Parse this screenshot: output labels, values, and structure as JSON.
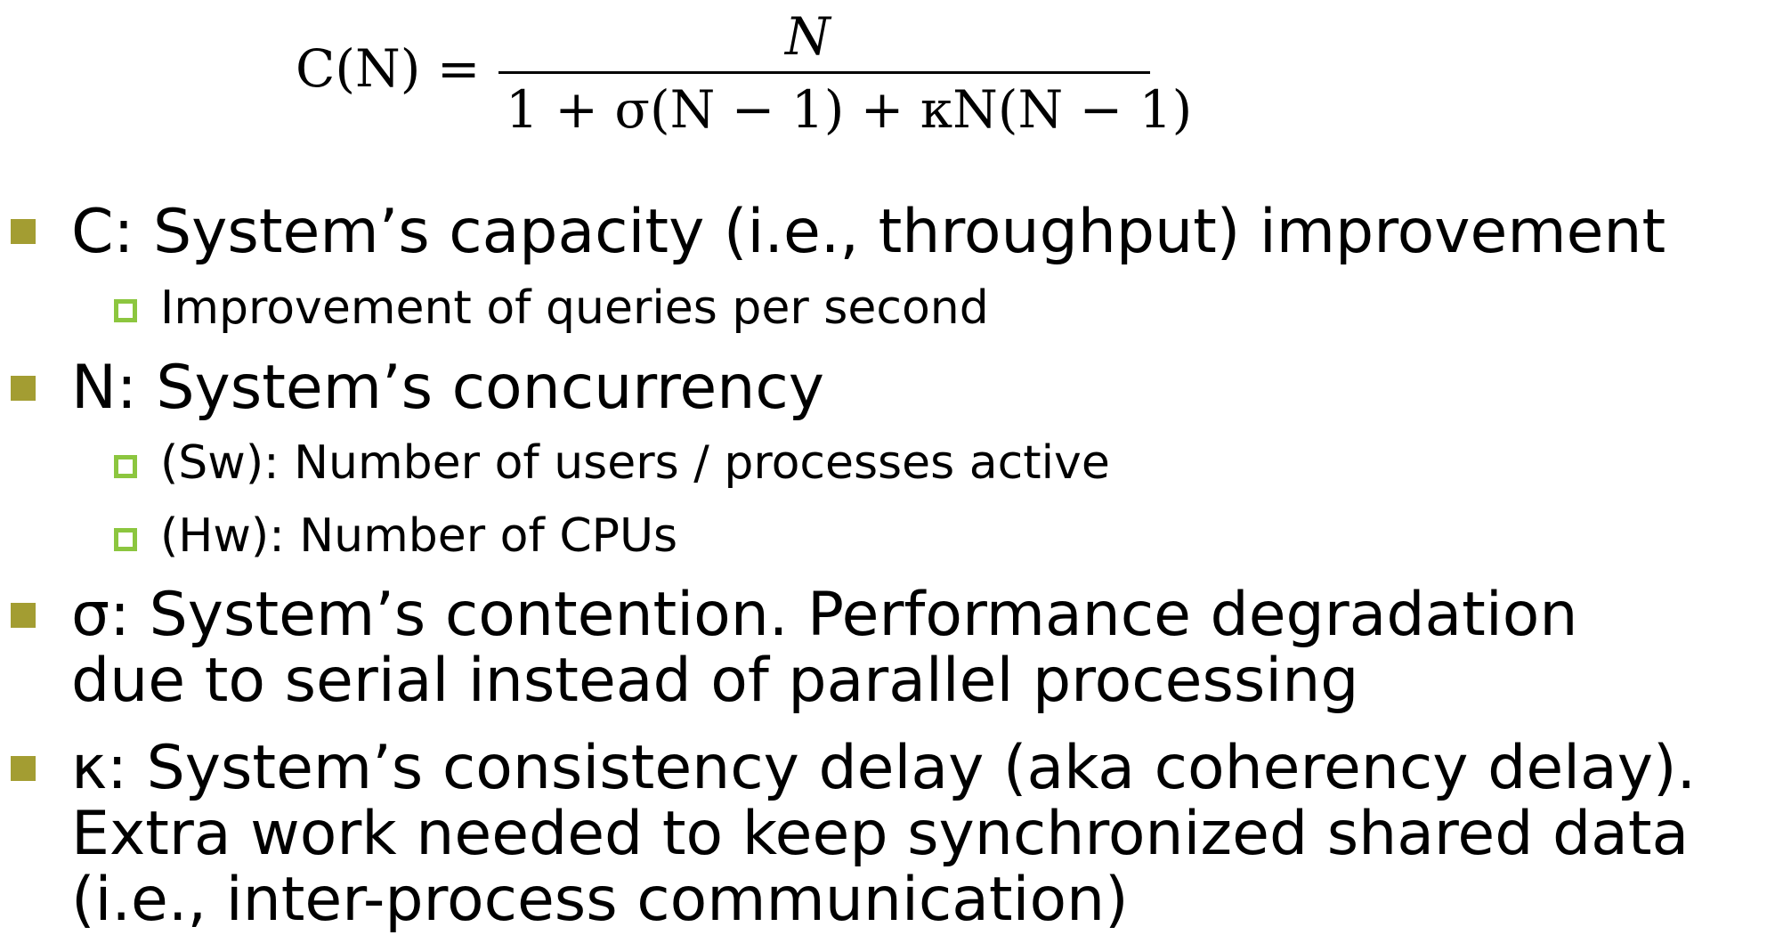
{
  "formula": {
    "lhs": "C(N) =",
    "numerator": "N",
    "denominator": "1 + σ(N − 1) + κN(N − 1)"
  },
  "colors": {
    "bullet_level1": "#A39D32",
    "bullet_level2": "#8CC63F",
    "text": "#000000"
  },
  "bullets": [
    {
      "text": "C: System’s capacity (i.e., throughput) improvement",
      "sub": [
        "Improvement of queries per second"
      ]
    },
    {
      "text": "N: System’s concurrency",
      "sub": [
        "(Sw): Number of users / processes active",
        "(Hw): Number of CPUs"
      ]
    },
    {
      "lines": [
        "σ: System’s contention. Performance degradation",
        "due to serial instead of parallel processing"
      ]
    },
    {
      "lines": [
        "κ: System’s consistency delay (aka coherency delay).",
        "Extra work needed to keep synchronized shared data",
        "(i.e., inter-process communication)"
      ]
    }
  ]
}
